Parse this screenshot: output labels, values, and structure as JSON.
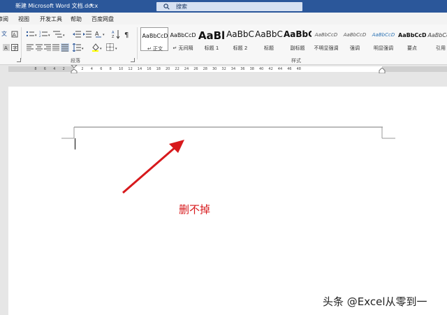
{
  "window": {
    "title": "新建 Microsoft Word 文档.docx",
    "title_caret": "▾",
    "search_placeholder": "搜索"
  },
  "menu_tabs": [
    "审阅",
    "视图",
    "开发工具",
    "帮助",
    "百度网盘"
  ],
  "ribbon": {
    "paragraph_group_label": "段落",
    "styles_group_label": "样式",
    "styles": [
      {
        "sample": "AaBbCcD",
        "name": "↵ 正文",
        "selected": true
      },
      {
        "sample": "AaBbCcD",
        "name": "↵ 无间隔"
      },
      {
        "sample": "AaBl",
        "name": "标题 1"
      },
      {
        "sample": "AaBbC",
        "name": "标题 2"
      },
      {
        "sample": "AaBbC",
        "name": "标题"
      },
      {
        "sample": "AaBbC",
        "name": "副标题"
      },
      {
        "sample": "AaBbCcD",
        "name": "不明显强调"
      },
      {
        "sample": "AaBbCcD",
        "name": "强调"
      },
      {
        "sample": "AaBbCcD",
        "name": "明显强调"
      },
      {
        "sample": "AaBbCcD",
        "name": "要点"
      },
      {
        "sample": "AaBbCcD",
        "name": "引用"
      }
    ]
  },
  "ruler": {
    "numbers": [
      "8",
      "6",
      "4",
      "2",
      "2",
      "4",
      "6",
      "8",
      "10",
      "12",
      "14",
      "16",
      "18",
      "20",
      "22",
      "24",
      "26",
      "28",
      "30",
      "32",
      "34",
      "36",
      "38",
      "40",
      "42",
      "44",
      "46",
      "48"
    ]
  },
  "document": {
    "annotation_text": "删不掉",
    "watermark_text": "头条 @Excel从零到一"
  },
  "colors": {
    "title_bar": "#2b579a",
    "annotation": "#d7191c"
  }
}
